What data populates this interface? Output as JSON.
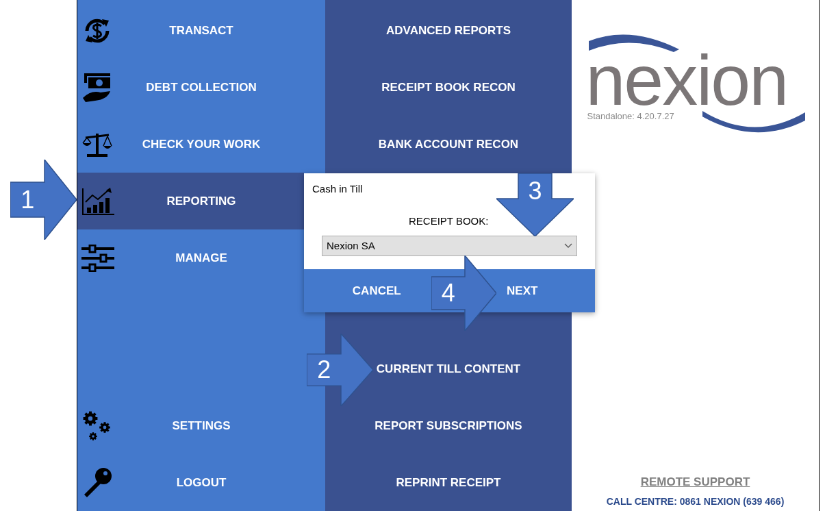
{
  "main_menu": {
    "top": [
      {
        "label": "TRANSACT",
        "selected": false
      },
      {
        "label": "DEBT COLLECTION",
        "selected": false
      },
      {
        "label": "CHECK YOUR WORK",
        "selected": false
      },
      {
        "label": "REPORTING",
        "selected": true
      },
      {
        "label": "MANAGE",
        "selected": false
      }
    ],
    "bottom": [
      {
        "label": "SETTINGS",
        "selected": false
      },
      {
        "label": "LOGOUT",
        "selected": false
      }
    ]
  },
  "report_menu": {
    "upper": [
      "ADVANCED REPORTS",
      "RECEIPT BOOK RECON",
      "BANK ACCOUNT RECON"
    ],
    "lower": [
      "CURRENT TILL CONTENT",
      "REPORT SUBSCRIPTIONS",
      "REPRINT RECEIPT"
    ]
  },
  "dialog": {
    "title": "Cash in Till",
    "field_label": "RECEIPT BOOK:",
    "select_value": "Nexion SA",
    "buttons": [
      "CANCEL",
      "NEXT"
    ]
  },
  "logo": {
    "wordmark": "nexion",
    "version": "Standalone: 4.20.7.27"
  },
  "footer": {
    "link": "REMOTE SUPPORT",
    "call_centre": "CALL CENTRE: 0861 NEXION (639 466)"
  },
  "callouts": [
    {
      "number": "1",
      "kind": "right"
    },
    {
      "number": "2",
      "kind": "right"
    },
    {
      "number": "3",
      "kind": "down"
    },
    {
      "number": "4",
      "kind": "right"
    }
  ]
}
